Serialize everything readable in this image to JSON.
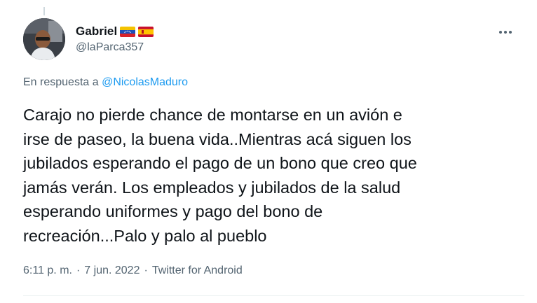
{
  "author": {
    "display_name": "Gabriel",
    "handle": "@laParca357",
    "flags": [
      "venezuela-flag",
      "spain-flag"
    ]
  },
  "reply": {
    "prefix": "En respuesta a",
    "mention": "@NicolasMaduro"
  },
  "tweet": {
    "text": "Carajo no pierde chance de montarse en un avión e\nirse de paseo, la buena vida..Mientras acá siguen los\njubilados esperando el pago de un bono que creo que\njamás verán. Los empleados y jubilados de la salud\nesperando uniformes y pago del bono de\nrecreación...Palo y palo al pueblo"
  },
  "meta": {
    "time": "6:11 p. m.",
    "separator": "·",
    "date": "7 jun. 2022",
    "source": "Twitter for Android"
  },
  "colors": {
    "text": "#0f1419",
    "secondary": "#536471",
    "link": "#1d9bf0"
  }
}
